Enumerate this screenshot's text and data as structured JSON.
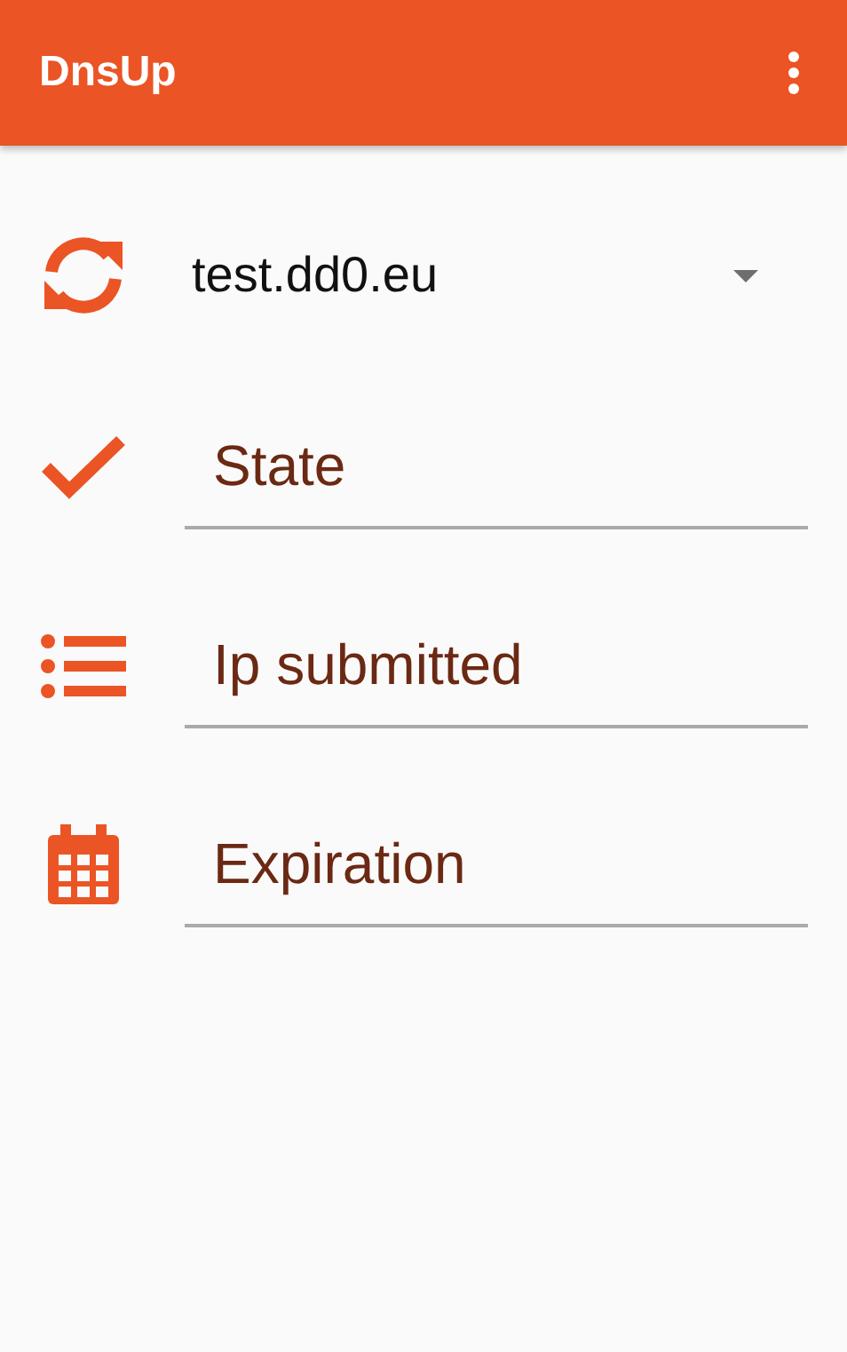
{
  "app_bar": {
    "title": "DnsUp"
  },
  "domain_select": {
    "value": "test.dd0.eu"
  },
  "fields": [
    {
      "kind": "state",
      "placeholder": "State"
    },
    {
      "kind": "ip",
      "placeholder": "Ip submitted"
    },
    {
      "kind": "expiration",
      "placeholder": "Expiration"
    }
  ]
}
